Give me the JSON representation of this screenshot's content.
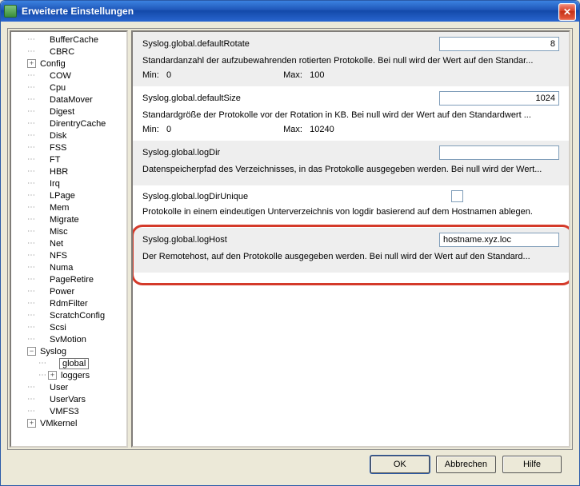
{
  "window": {
    "title": "Erweiterte Einstellungen"
  },
  "tree": {
    "items": [
      {
        "label": "BufferCache",
        "indent": 1,
        "exp": null
      },
      {
        "label": "CBRC",
        "indent": 1,
        "exp": null
      },
      {
        "label": "Config",
        "indent": 1,
        "exp": "+"
      },
      {
        "label": "COW",
        "indent": 1,
        "exp": null
      },
      {
        "label": "Cpu",
        "indent": 1,
        "exp": null
      },
      {
        "label": "DataMover",
        "indent": 1,
        "exp": null
      },
      {
        "label": "Digest",
        "indent": 1,
        "exp": null
      },
      {
        "label": "DirentryCache",
        "indent": 1,
        "exp": null
      },
      {
        "label": "Disk",
        "indent": 1,
        "exp": null
      },
      {
        "label": "FSS",
        "indent": 1,
        "exp": null
      },
      {
        "label": "FT",
        "indent": 1,
        "exp": null
      },
      {
        "label": "HBR",
        "indent": 1,
        "exp": null
      },
      {
        "label": "Irq",
        "indent": 1,
        "exp": null
      },
      {
        "label": "LPage",
        "indent": 1,
        "exp": null
      },
      {
        "label": "Mem",
        "indent": 1,
        "exp": null
      },
      {
        "label": "Migrate",
        "indent": 1,
        "exp": null
      },
      {
        "label": "Misc",
        "indent": 1,
        "exp": null
      },
      {
        "label": "Net",
        "indent": 1,
        "exp": null
      },
      {
        "label": "NFS",
        "indent": 1,
        "exp": null
      },
      {
        "label": "Numa",
        "indent": 1,
        "exp": null
      },
      {
        "label": "PageRetire",
        "indent": 1,
        "exp": null
      },
      {
        "label": "Power",
        "indent": 1,
        "exp": null
      },
      {
        "label": "RdmFilter",
        "indent": 1,
        "exp": null
      },
      {
        "label": "ScratchConfig",
        "indent": 1,
        "exp": null
      },
      {
        "label": "Scsi",
        "indent": 1,
        "exp": null
      },
      {
        "label": "SvMotion",
        "indent": 1,
        "exp": null
      },
      {
        "label": "Syslog",
        "indent": 1,
        "exp": "-"
      },
      {
        "label": "global",
        "indent": 2,
        "exp": null,
        "selected": true
      },
      {
        "label": "loggers",
        "indent": 2,
        "exp": "+"
      },
      {
        "label": "User",
        "indent": 1,
        "exp": null
      },
      {
        "label": "UserVars",
        "indent": 1,
        "exp": null
      },
      {
        "label": "VMFS3",
        "indent": 1,
        "exp": null
      },
      {
        "label": "VMkernel",
        "indent": 1,
        "exp": "+"
      }
    ]
  },
  "settings": [
    {
      "name": "Syslog.global.defaultRotate",
      "value": "8",
      "desc": "Standardanzahl der aufzubewahrenden rotierten Protokolle. Bei null wird der Wert auf den Standar...",
      "min_label": "Min:",
      "min": "0",
      "max_label": "Max:",
      "max": "100",
      "type": "text-right",
      "alt": true
    },
    {
      "name": "Syslog.global.defaultSize",
      "value": "1024",
      "desc": "Standardgröße der Protokolle vor der Rotation in KB. Bei null wird der Wert auf den Standardwert ...",
      "min_label": "Min:",
      "min": "0",
      "max_label": "Max:",
      "max": "10240",
      "type": "text-right",
      "alt": false
    },
    {
      "name": "Syslog.global.logDir",
      "value": "",
      "desc": "Datenspeicherpfad des Verzeichnisses, in das Protokolle ausgegeben werden. Bei null wird der Wert...",
      "type": "text-left",
      "alt": true
    },
    {
      "name": "Syslog.global.logDirUnique",
      "value": "",
      "desc": "Protokolle in einem eindeutigen Unterverzeichnis von logdir basierend auf dem Hostnamen ablegen.",
      "type": "checkbox",
      "alt": false
    },
    {
      "name": "Syslog.global.logHost",
      "value": "hostname.xyz.loc",
      "desc": "Der Remotehost, auf den Protokolle ausgegeben werden. Bei null wird der Wert auf den Standard...",
      "type": "text-left",
      "alt": true,
      "highlighted": true
    }
  ],
  "buttons": {
    "ok": "OK",
    "cancel": "Abbrechen",
    "help": "Hilfe"
  }
}
